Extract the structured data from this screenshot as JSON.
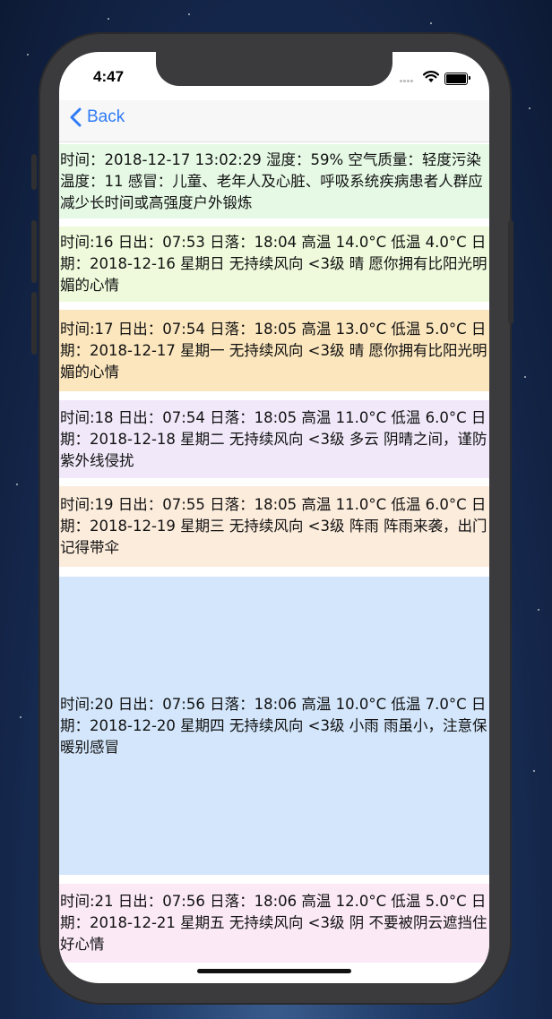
{
  "status_bar": {
    "time": "4:47"
  },
  "nav": {
    "back_label": "Back"
  },
  "rows": [
    {
      "text": "时间：2018-12-17 13:02:29 湿度：59% 空气质量：轻度污染 温度：11 感冒：儿童、老年人及心脏、呼吸系统疾病患者人群应减少长时间或高强度户外锻炼",
      "color": "#e5f9e5"
    },
    {
      "text": "时间:16 日出：07:53 日落：18:04 高温 14.0°C 低温 4.0°C  日期：2018-12-16 星期日  无持续风向 <3级 晴 愿你拥有比阳光明媚的心情",
      "color": "#eefadb"
    },
    {
      "text": "时间:17 日出：07:54 日落：18:05 高温 13.0°C 低温 5.0°C  日期：2018-12-17 星期一  无持续风向 <3级 晴 愿你拥有比阳光明媚的心情",
      "color": "#fbe6bd"
    },
    {
      "text": "时间:18 日出：07:54 日落：18:05 高温 11.0°C 低温 6.0°C  日期：2018-12-18 星期二  无持续风向 <3级 多云 阴晴之间，谨防紫外线侵扰",
      "color": "#f1e9fa"
    },
    {
      "text": "时间:19 日出：07:55 日落：18:05 高温 11.0°C 低温 6.0°C  日期：2018-12-19 星期三  无持续风向 <3级 阵雨 阵雨来袭，出门记得带伞",
      "color": "#fcecdc"
    },
    {
      "text": "时间:20 日出：07:56 日落：18:06 高温 10.0°C 低温 7.0°C  日期：2018-12-20 星期四  无持续风向 <3级 小雨 雨虽小，注意保暖别感冒",
      "color": "#d3e6fb"
    },
    {
      "text": "时间:21 日出：07:56 日落：18:06 高温 12.0°C 低温 5.0°C  日期：2018-12-21 星期五  无持续风向 <3级 阴 不要被阴云遮挡住好心情",
      "color": "#fbe9f6"
    }
  ]
}
